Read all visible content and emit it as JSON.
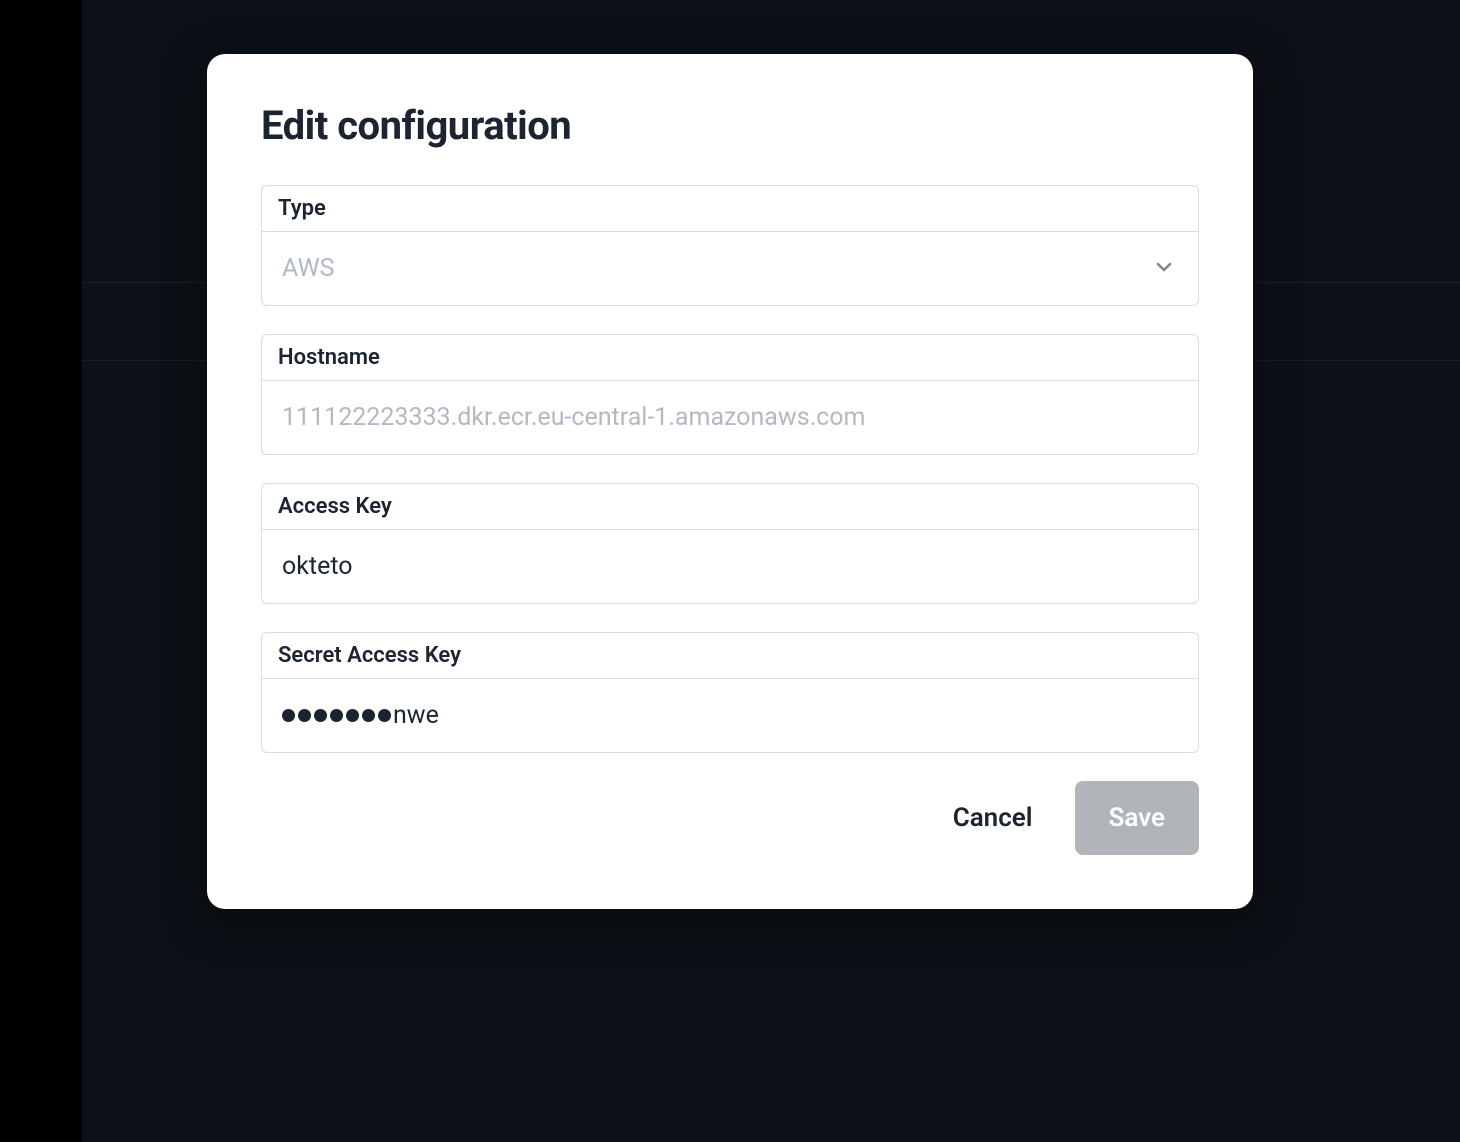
{
  "modal": {
    "title": "Edit configuration",
    "fields": {
      "type": {
        "label": "Type",
        "value": "AWS"
      },
      "hostname": {
        "label": "Hostname",
        "placeholder": "111122223333.dkr.ecr.eu-central-1.amazonaws.com",
        "value": ""
      },
      "accessKey": {
        "label": "Access Key",
        "value": "okteto"
      },
      "secretAccessKey": {
        "label": "Secret Access Key",
        "maskedDots": 7,
        "visibleSuffix": "nwe"
      }
    },
    "actions": {
      "cancel": "Cancel",
      "save": "Save"
    }
  }
}
